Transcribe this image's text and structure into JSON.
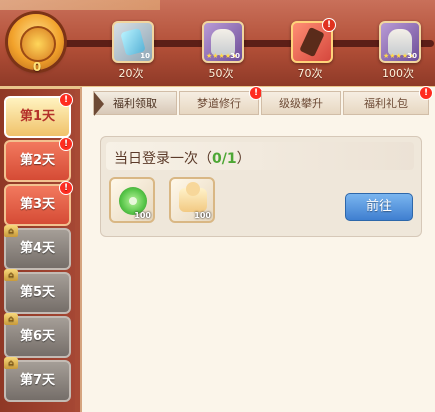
{
  "top": {
    "medal_count": "0",
    "progress": 0,
    "rewards": [
      {
        "label": "20次",
        "kind": "gem",
        "count": "10"
      },
      {
        "label": "50次",
        "kind": "hero",
        "count": "30"
      },
      {
        "label": "70次",
        "kind": "hero-red",
        "count": "",
        "alert": "!"
      },
      {
        "label": "100次",
        "kind": "hero",
        "count": "30"
      }
    ]
  },
  "sidebar": {
    "days": [
      {
        "label": "第1天",
        "state": "active",
        "alert": "!"
      },
      {
        "label": "第2天",
        "state": "normal",
        "alert": "!"
      },
      {
        "label": "第3天",
        "state": "normal",
        "alert": "!"
      },
      {
        "label": "第4天",
        "state": "locked"
      },
      {
        "label": "第5天",
        "state": "locked"
      },
      {
        "label": "第6天",
        "state": "locked"
      },
      {
        "label": "第7天",
        "state": "locked"
      }
    ]
  },
  "tabs": [
    {
      "label": "福利领取",
      "active": true
    },
    {
      "label": "梦道修行",
      "alert": "!"
    },
    {
      "label": "级级攀升"
    },
    {
      "label": "福利礼包",
      "alert": "!"
    }
  ],
  "task": {
    "title_prefix": "当日登录一次（",
    "progress_text": "0/1",
    "title_suffix": "）",
    "items": [
      {
        "count": "100",
        "icon": "jade-icon"
      },
      {
        "count": "100",
        "icon": "cake-icon"
      }
    ],
    "button": "前往"
  },
  "colors": {
    "accent_red": "#d54b35",
    "active_yellow": "#f0c26a",
    "locked_gray": "#756e69",
    "button_blue": "#3f7fd0"
  }
}
